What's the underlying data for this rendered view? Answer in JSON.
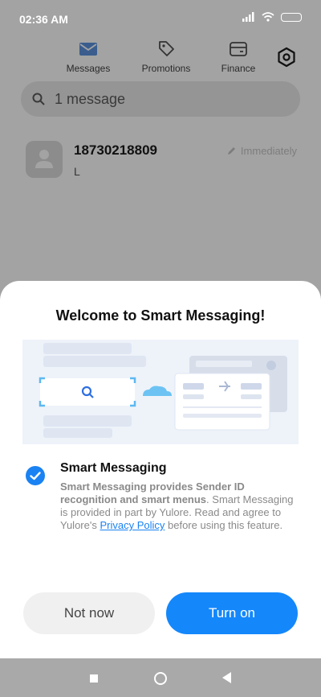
{
  "status_bar": {
    "time": "02:36 AM",
    "icons": [
      "signal-icon",
      "wifi-icon",
      "battery-icon"
    ]
  },
  "tabs": [
    {
      "label": "Messages",
      "icon": "envelope-icon",
      "active": true
    },
    {
      "label": "Promotions",
      "icon": "tag-icon",
      "active": false
    },
    {
      "label": "Finance",
      "icon": "card-icon",
      "active": false
    }
  ],
  "settings_icon": "gear-icon",
  "search": {
    "text": "1 message",
    "icon": "search-icon"
  },
  "conversation": {
    "sender": "18730218809",
    "preview": "L",
    "time": "Immediately",
    "time_icon": "pencil-icon"
  },
  "sheet": {
    "title": "Welcome to Smart Messaging!",
    "option": {
      "checked": true,
      "title": "Smart Messaging",
      "desc_bold": "Smart Messaging provides Sender ID recognition and smart menus",
      "desc_part1": ". Smart Messaging is provided in part by Yulore. Read and agree to Yulore's ",
      "link": "Privacy Policy",
      "desc_part2": " before using this feature."
    },
    "buttons": {
      "secondary": "Not now",
      "primary": "Turn on"
    }
  },
  "colors": {
    "accent": "#1487fb",
    "check": "#1a82f2",
    "dim_background": "#a3a3a3"
  }
}
